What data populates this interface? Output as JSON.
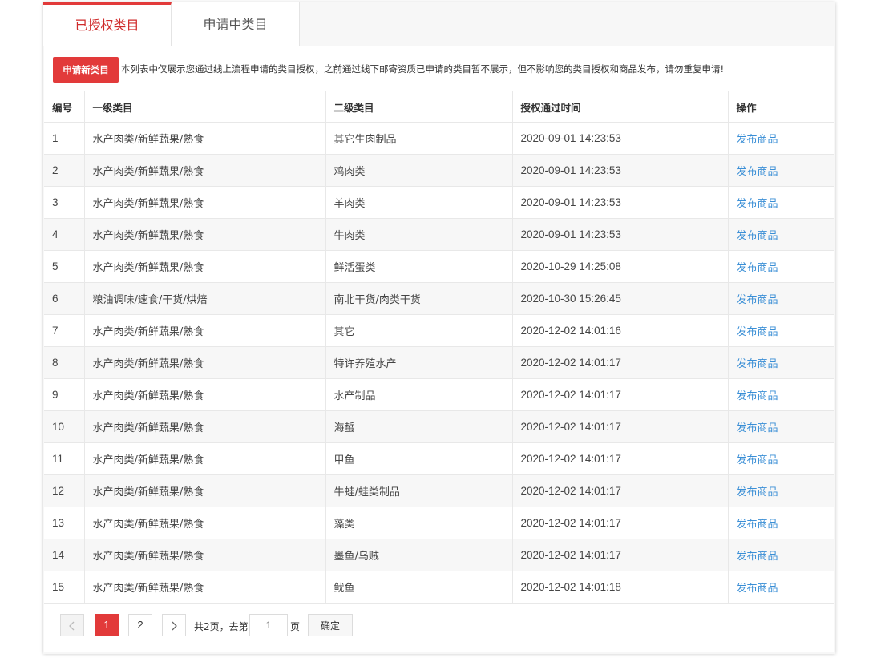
{
  "tabs": [
    {
      "label": "已授权类目",
      "active": true
    },
    {
      "label": "申请中类目",
      "active": false
    }
  ],
  "notice": {
    "apply_button": "申请新类目",
    "text": "本列表中仅展示您通过线上流程申请的类目授权，之前通过线下邮寄资质已申请的类目暂不展示，但不影响您的类目授权和商品发布，请勿重复申请!"
  },
  "table": {
    "headers": [
      "编号",
      "一级类目",
      "二级类目",
      "授权通过时间",
      "操作"
    ],
    "rows": [
      {
        "idx": "1",
        "cat1": "水产肉类/新鲜蔬果/熟食",
        "cat2": "其它生肉制品",
        "time": "2020-09-01 14:23:53",
        "action": "发布商品"
      },
      {
        "idx": "2",
        "cat1": "水产肉类/新鲜蔬果/熟食",
        "cat2": "鸡肉类",
        "time": "2020-09-01 14:23:53",
        "action": "发布商品"
      },
      {
        "idx": "3",
        "cat1": "水产肉类/新鲜蔬果/熟食",
        "cat2": "羊肉类",
        "time": "2020-09-01 14:23:53",
        "action": "发布商品"
      },
      {
        "idx": "4",
        "cat1": "水产肉类/新鲜蔬果/熟食",
        "cat2": "牛肉类",
        "time": "2020-09-01 14:23:53",
        "action": "发布商品"
      },
      {
        "idx": "5",
        "cat1": "水产肉类/新鲜蔬果/熟食",
        "cat2": "鲜活蛋类",
        "time": "2020-10-29 14:25:08",
        "action": "发布商品"
      },
      {
        "idx": "6",
        "cat1": "粮油调味/速食/干货/烘焙",
        "cat2": "南北干货/肉类干货",
        "time": "2020-10-30 15:26:45",
        "action": "发布商品"
      },
      {
        "idx": "7",
        "cat1": "水产肉类/新鲜蔬果/熟食",
        "cat2": "其它",
        "time": "2020-12-02 14:01:16",
        "action": "发布商品"
      },
      {
        "idx": "8",
        "cat1": "水产肉类/新鲜蔬果/熟食",
        "cat2": "特许养殖水产",
        "time": "2020-12-02 14:01:17",
        "action": "发布商品"
      },
      {
        "idx": "9",
        "cat1": "水产肉类/新鲜蔬果/熟食",
        "cat2": "水产制品",
        "time": "2020-12-02 14:01:17",
        "action": "发布商品"
      },
      {
        "idx": "10",
        "cat1": "水产肉类/新鲜蔬果/熟食",
        "cat2": "海蜇",
        "time": "2020-12-02 14:01:17",
        "action": "发布商品"
      },
      {
        "idx": "11",
        "cat1": "水产肉类/新鲜蔬果/熟食",
        "cat2": "甲鱼",
        "time": "2020-12-02 14:01:17",
        "action": "发布商品"
      },
      {
        "idx": "12",
        "cat1": "水产肉类/新鲜蔬果/熟食",
        "cat2": "牛蛙/蛙类制品",
        "time": "2020-12-02 14:01:17",
        "action": "发布商品"
      },
      {
        "idx": "13",
        "cat1": "水产肉类/新鲜蔬果/熟食",
        "cat2": "藻类",
        "time": "2020-12-02 14:01:17",
        "action": "发布商品"
      },
      {
        "idx": "14",
        "cat1": "水产肉类/新鲜蔬果/熟食",
        "cat2": "墨鱼/乌贼",
        "time": "2020-12-02 14:01:17",
        "action": "发布商品"
      },
      {
        "idx": "15",
        "cat1": "水产肉类/新鲜蔬果/熟食",
        "cat2": "鱿鱼",
        "time": "2020-12-02 14:01:18",
        "action": "发布商品"
      }
    ]
  },
  "pagination": {
    "prev_icon": "chevron-left-icon",
    "next_icon": "chevron-right-icon",
    "pages": [
      "1",
      "2"
    ],
    "current_page": "1",
    "total_text": "共2页，去第",
    "goto_value": "1",
    "suffix": "页",
    "confirm_label": "确定"
  },
  "colors": {
    "accent": "#e23a3a",
    "link": "#3b8fd6"
  }
}
